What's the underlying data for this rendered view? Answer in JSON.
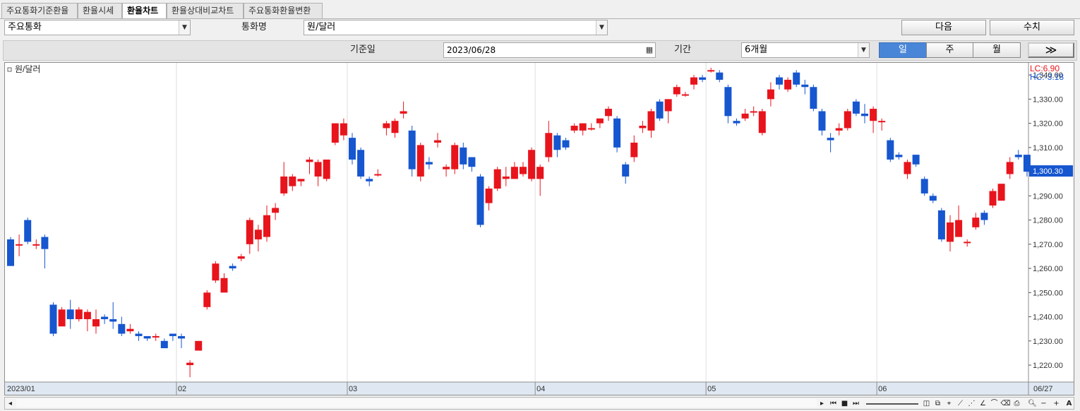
{
  "tabs": [
    "주요통화기준환율",
    "환율시세",
    "환율차트",
    "환율상대비교차트",
    "주요통화환율변환"
  ],
  "active_tab": 2,
  "toolbar": {
    "category": "주요통화",
    "currency_label": "통화명",
    "currency": "원/달러",
    "next_label": "다음",
    "values_label": "수치",
    "date_label": "기준일",
    "date_value": "2023/06/28",
    "period_label": "기간",
    "period_value": "6개월",
    "seg_day": "일",
    "seg_week": "주",
    "seg_month": "월",
    "expand_label": "≫"
  },
  "chart_data": {
    "type": "candlestick",
    "legend": "원/달러",
    "lc_label": "LC:6.90",
    "hc_label": "HC:-3.18",
    "last_value_label": "1,300.30",
    "last_value": 1300.3,
    "up_color": "#e8141c",
    "down_color": "#1656cf",
    "ylim": [
      1213,
      1345
    ],
    "yticks": [
      1220,
      1230,
      1240,
      1250,
      1260,
      1270,
      1280,
      1290,
      1300,
      1310,
      1320,
      1330,
      1340
    ],
    "ytick_labels": [
      "1,220.00",
      "1,230.00",
      "1,240.00",
      "1,250.00",
      "1,260.00",
      "1,270.00",
      "1,280.00",
      "1,290.00",
      "1,300.00",
      "1,310.00",
      "1,320.00",
      "1,330.00",
      "1,340.00"
    ],
    "month_labels": [
      {
        "label": "2023/01",
        "index": 0
      },
      {
        "label": "02",
        "index": 20
      },
      {
        "label": "03",
        "index": 40
      },
      {
        "label": "04",
        "index": 62
      },
      {
        "label": "05",
        "index": 82
      },
      {
        "label": "06",
        "index": 102
      },
      {
        "label": "06/27",
        "index": 119
      }
    ],
    "candles": [
      [
        1272,
        1261,
        1273,
        1261
      ],
      [
        1270,
        1270,
        1274,
        1265
      ],
      [
        1280,
        1271,
        1281,
        1270
      ],
      [
        1270,
        1270,
        1272,
        1268
      ],
      [
        1273,
        1268,
        1274,
        1260
      ],
      [
        1245,
        1233,
        1246,
        1232
      ],
      [
        1236,
        1243,
        1244,
        1237
      ],
      [
        1243,
        1239,
        1247,
        1235
      ],
      [
        1239,
        1243,
        1244,
        1238
      ],
      [
        1239,
        1242,
        1243,
        1234
      ],
      [
        1236,
        1239,
        1243,
        1233
      ],
      [
        1240,
        1239,
        1241,
        1237
      ],
      [
        1239,
        1238,
        1246,
        1235
      ],
      [
        1237,
        1233,
        1240,
        1232
      ],
      [
        1234,
        1235,
        1237,
        1233
      ],
      [
        1233,
        1232,
        1234,
        1230
      ],
      [
        1232,
        1231,
        1232,
        1230
      ],
      [
        1232,
        1232,
        1233,
        1230
      ],
      [
        1230,
        1227,
        1231,
        1227
      ],
      [
        1233,
        1232,
        1233,
        1230
      ],
      [
        1232,
        1231,
        1233,
        1227
      ],
      [
        1220,
        1221,
        1222,
        1215
      ],
      [
        1226,
        1230,
        1230,
        1226
      ],
      [
        1244,
        1250,
        1251,
        1243
      ],
      [
        1255,
        1262,
        1263,
        1254
      ],
      [
        1250,
        1256,
        1258,
        1251
      ],
      [
        1261,
        1260,
        1262,
        1259
      ],
      [
        1264,
        1265,
        1266,
        1263
      ],
      [
        1270,
        1280,
        1281,
        1266
      ],
      [
        1272,
        1276,
        1278,
        1267
      ],
      [
        1273,
        1282,
        1286,
        1271
      ],
      [
        1283,
        1285,
        1287,
        1280
      ],
      [
        1291,
        1298,
        1304,
        1290
      ],
      [
        1294,
        1298,
        1299,
        1292
      ],
      [
        1296,
        1297,
        1297,
        1294
      ],
      [
        1304,
        1305,
        1306,
        1299
      ],
      [
        1298,
        1304,
        1305,
        1294
      ],
      [
        1297,
        1305,
        1305,
        1296
      ],
      [
        1312,
        1320,
        1320,
        1311
      ],
      [
        1315,
        1320,
        1322,
        1313
      ],
      [
        1314,
        1305,
        1316,
        1303
      ],
      [
        1309,
        1298,
        1310,
        1297
      ],
      [
        1297,
        1296,
        1298,
        1294
      ],
      [
        1299,
        1299,
        1301,
        1298
      ],
      [
        1318,
        1320,
        1321,
        1315
      ],
      [
        1316,
        1321,
        1322,
        1314
      ],
      [
        1324,
        1325,
        1329,
        1322
      ],
      [
        1317,
        1301,
        1319,
        1298
      ],
      [
        1298,
        1311,
        1312,
        1296
      ],
      [
        1304,
        1303,
        1306,
        1301
      ],
      [
        1312,
        1313,
        1316,
        1310
      ],
      [
        1301,
        1302,
        1303,
        1298
      ],
      [
        1301,
        1311,
        1312,
        1299
      ],
      [
        1310,
        1303,
        1312,
        1301
      ],
      [
        1306,
        1302,
        1306,
        1300
      ],
      [
        1298,
        1278,
        1299,
        1277
      ],
      [
        1287,
        1293,
        1294,
        1284
      ],
      [
        1293,
        1301,
        1302,
        1292
      ],
      [
        1297,
        1298,
        1302,
        1294
      ],
      [
        1297,
        1302,
        1304,
        1297
      ],
      [
        1299,
        1302,
        1304,
        1298
      ],
      [
        1297,
        1309,
        1310,
        1296
      ],
      [
        1297,
        1302,
        1303,
        1290
      ],
      [
        1306,
        1316,
        1321,
        1304
      ],
      [
        1315,
        1309,
        1316,
        1306
      ],
      [
        1313,
        1310,
        1314,
        1309
      ],
      [
        1317,
        1319,
        1320,
        1316
      ],
      [
        1317,
        1320,
        1320,
        1315
      ],
      [
        1318,
        1318,
        1320,
        1317
      ],
      [
        1320,
        1322,
        1322,
        1318
      ],
      [
        1323,
        1326,
        1327,
        1321
      ],
      [
        1322,
        1310,
        1323,
        1308
      ],
      [
        1303,
        1298,
        1304,
        1295
      ],
      [
        1306,
        1312,
        1315,
        1304
      ],
      [
        1318,
        1319,
        1321,
        1316
      ],
      [
        1317,
        1325,
        1326,
        1314
      ],
      [
        1329,
        1322,
        1330,
        1321
      ],
      [
        1325,
        1330,
        1330,
        1320
      ],
      [
        1332,
        1335,
        1336,
        1331
      ],
      [
        1332,
        1332,
        1333,
        1331
      ],
      [
        1336,
        1339,
        1340,
        1334
      ],
      [
        1339,
        1338,
        1340,
        1337
      ],
      [
        1342,
        1342,
        1343,
        1341
      ],
      [
        1341,
        1338,
        1342,
        1337
      ],
      [
        1335,
        1323,
        1336,
        1320
      ],
      [
        1321,
        1320,
        1322,
        1319
      ],
      [
        1322,
        1324,
        1326,
        1321
      ],
      [
        1325,
        1325,
        1327,
        1323
      ],
      [
        1316,
        1325,
        1326,
        1315
      ],
      [
        1330,
        1334,
        1337,
        1327
      ],
      [
        1339,
        1336,
        1340,
        1334
      ],
      [
        1334,
        1338,
        1339,
        1333
      ],
      [
        1341,
        1336,
        1342,
        1335
      ],
      [
        1336,
        1335,
        1338,
        1332
      ],
      [
        1335,
        1326,
        1336,
        1325
      ],
      [
        1325,
        1317,
        1326,
        1315
      ],
      [
        1314,
        1313,
        1316,
        1308
      ],
      [
        1317,
        1318,
        1320,
        1315
      ],
      [
        1318,
        1325,
        1326,
        1317
      ],
      [
        1329,
        1324,
        1330,
        1323
      ],
      [
        1324,
        1323,
        1328,
        1320
      ],
      [
        1321,
        1326,
        1327,
        1316
      ],
      [
        1321,
        1321,
        1322,
        1317
      ],
      [
        1313,
        1305,
        1314,
        1304
      ],
      [
        1307,
        1306,
        1308,
        1305
      ],
      [
        1299,
        1304,
        1305,
        1297
      ],
      [
        1307,
        1303,
        1307,
        1302
      ],
      [
        1297,
        1291,
        1298,
        1290
      ],
      [
        1290,
        1288,
        1291,
        1287
      ],
      [
        1284,
        1272,
        1285,
        1271
      ],
      [
        1271,
        1279,
        1282,
        1267
      ],
      [
        1273,
        1280,
        1286,
        1273
      ],
      [
        1271,
        1271,
        1272,
        1269
      ],
      [
        1277,
        1281,
        1283,
        1276
      ],
      [
        1283,
        1280,
        1284,
        1278
      ],
      [
        1286,
        1292,
        1293,
        1285
      ],
      [
        1288,
        1295,
        1295,
        1288
      ],
      [
        1299,
        1304,
        1306,
        1297
      ],
      [
        1307,
        1306,
        1309,
        1305
      ],
      [
        1307,
        1300,
        1307,
        1298
      ]
    ]
  }
}
